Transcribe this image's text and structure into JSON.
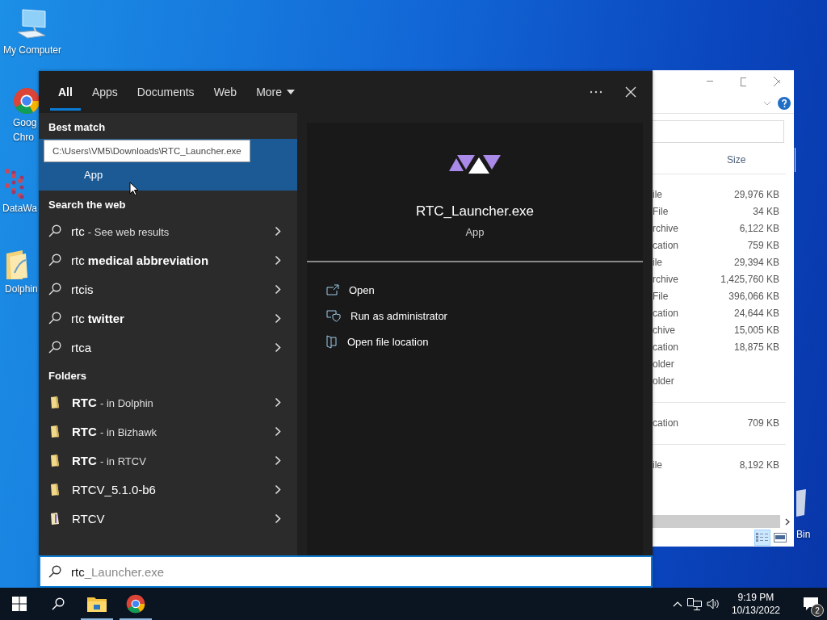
{
  "desktop_icons": [
    {
      "kind": "computer",
      "lines": [
        "My Computer"
      ]
    },
    {
      "kind": "browser",
      "lines": [
        "Goog",
        "Chro"
      ]
    },
    {
      "kind": "network",
      "lines": [
        "DataWa"
      ]
    },
    {
      "kind": "folder",
      "lines": [
        "Dolphin"
      ]
    },
    {
      "kind": "recycle",
      "lines": [
        "Bin"
      ]
    }
  ],
  "explorer": {
    "size_header": "Size",
    "groups": [
      {
        "rows": [
          {
            "type": "ile",
            "size": "29,976 KB"
          },
          {
            "type": "File",
            "size": "34 KB"
          },
          {
            "type": "rchive",
            "size": "6,122 KB"
          },
          {
            "type": "cation",
            "size": "759 KB"
          },
          {
            "type": "ile",
            "size": "29,394 KB"
          },
          {
            "type": "rchive",
            "size": "1,425,760 KB"
          },
          {
            "type": "File",
            "size": "396,066 KB"
          },
          {
            "type": "cation",
            "size": "24,644 KB"
          },
          {
            "type": "chive",
            "size": "15,005 KB"
          },
          {
            "type": "cation",
            "size": "18,875 KB"
          },
          {
            "type": "older"
          },
          {
            "type": "older"
          }
        ]
      },
      {
        "rows": [
          {
            "type": "cation",
            "size": "709 KB"
          }
        ]
      },
      {
        "rows": [
          {
            "type": "ile",
            "size": "8,192 KB"
          }
        ]
      }
    ],
    "views": [
      {
        "kind": "details",
        "selected": true
      },
      {
        "kind": "preview",
        "selected": false
      }
    ]
  },
  "search": {
    "tabs": [
      {
        "label": "All",
        "selected": true
      },
      {
        "label": "Apps",
        "selected": false
      },
      {
        "label": "Documents",
        "selected": false
      },
      {
        "label": "Web",
        "selected": false
      }
    ],
    "more": "More",
    "best_match": {
      "heading": "Best match",
      "subtitle": "App",
      "selected": true,
      "tooltip": "C:\\Users\\VM5\\Downloads\\RTC_Launcher.exe"
    },
    "web": {
      "heading": "Search the web",
      "items": [
        {
          "text": "rtc",
          "note": "- See web results"
        },
        {
          "text": "rtc **medical abbreviation**"
        },
        {
          "text": "rtcis"
        },
        {
          "text": "rtc **twitter**"
        },
        {
          "text": "rtca"
        }
      ]
    },
    "folders": {
      "heading": "Folders",
      "items": [
        {
          "kind": "folder",
          "name": "**RTC**",
          "note": "- in Dolphin"
        },
        {
          "kind": "folder",
          "name": "**RTC**",
          "note": "- in Bizhawk"
        },
        {
          "kind": "folder",
          "name": "**RTC**",
          "note": "- in RTCV"
        },
        {
          "kind": "folder",
          "name": "RTCV_5.1.0-b6"
        },
        {
          "kind": "archive",
          "name": "RTCV"
        }
      ]
    },
    "preview": {
      "title": "RTC_Launcher.exe",
      "subtitle": "App",
      "actions": [
        {
          "kind": "open",
          "label": "Open"
        },
        {
          "kind": "admin",
          "label": "Run as administrator"
        },
        {
          "kind": "location",
          "label": "Open file location"
        }
      ]
    },
    "box": {
      "value": "rtc",
      "completion": "_Launcher.exe"
    }
  },
  "taskbar": {
    "apps": [
      {
        "kind": "explorer",
        "running": true
      },
      {
        "kind": "browser",
        "running": true
      }
    ],
    "time": "9:19 PM",
    "date": "10/13/2022",
    "notifications": "2"
  }
}
